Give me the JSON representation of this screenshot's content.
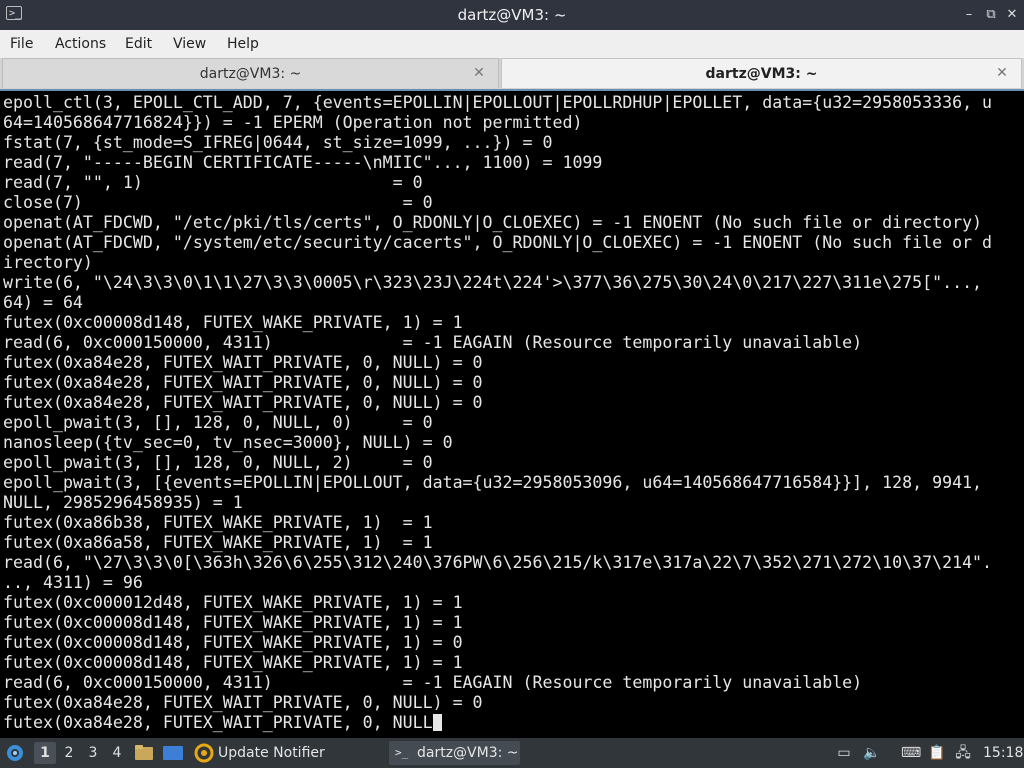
{
  "window": {
    "title": "dartz@VM3: ~",
    "controls": {
      "minimize": "–",
      "maximize": "⧉",
      "close": "✕"
    }
  },
  "menu": [
    "File",
    "Actions",
    "Edit",
    "View",
    "Help"
  ],
  "tabs": [
    {
      "label": "dartz@VM3: ~",
      "active": false
    },
    {
      "label": "dartz@VM3: ~",
      "active": true
    }
  ],
  "terminal": {
    "lines": [
      "epoll_ctl(3, EPOLL_CTL_ADD, 7, {events=EPOLLIN|EPOLLOUT|EPOLLRDHUP|EPOLLET, data={u32=2958053336, u",
      "64=140568647716824}}) = -1 EPERM (Operation not permitted)",
      "fstat(7, {st_mode=S_IFREG|0644, st_size=1099, ...}) = 0",
      "read(7, \"-----BEGIN CERTIFICATE-----\\nMIIC\"..., 1100) = 1099",
      "read(7, \"\", 1)                         = 0",
      "close(7)                                = 0",
      "openat(AT_FDCWD, \"/etc/pki/tls/certs\", O_RDONLY|O_CLOEXEC) = -1 ENOENT (No such file or directory)",
      "openat(AT_FDCWD, \"/system/etc/security/cacerts\", O_RDONLY|O_CLOEXEC) = -1 ENOENT (No such file or d",
      "irectory)",
      "write(6, \"\\24\\3\\3\\0\\1\\1\\27\\3\\3\\0005\\r\\323\\23J\\224t\\224'>\\377\\36\\275\\30\\24\\0\\217\\227\\311e\\275[\"...,",
      "64) = 64",
      "futex(0xc00008d148, FUTEX_WAKE_PRIVATE, 1) = 1",
      "read(6, 0xc000150000, 4311)             = -1 EAGAIN (Resource temporarily unavailable)",
      "futex(0xa84e28, FUTEX_WAIT_PRIVATE, 0, NULL) = 0",
      "futex(0xa84e28, FUTEX_WAIT_PRIVATE, 0, NULL) = 0",
      "futex(0xa84e28, FUTEX_WAIT_PRIVATE, 0, NULL) = 0",
      "epoll_pwait(3, [], 128, 0, NULL, 0)     = 0",
      "nanosleep({tv_sec=0, tv_nsec=3000}, NULL) = 0",
      "epoll_pwait(3, [], 128, 0, NULL, 2)     = 0",
      "epoll_pwait(3, [{events=EPOLLIN|EPOLLOUT, data={u32=2958053096, u64=140568647716584}}], 128, 9941,",
      "NULL, 2985296458935) = 1",
      "futex(0xa86b38, FUTEX_WAKE_PRIVATE, 1)  = 1",
      "futex(0xa86a58, FUTEX_WAKE_PRIVATE, 1)  = 1",
      "read(6, \"\\27\\3\\3\\0[\\363h\\326\\6\\255\\312\\240\\376PW\\6\\256\\215/k\\317e\\317a\\22\\7\\352\\271\\272\\10\\37\\214\".",
      ".., 4311) = 96",
      "futex(0xc000012d48, FUTEX_WAKE_PRIVATE, 1) = 1",
      "futex(0xc00008d148, FUTEX_WAKE_PRIVATE, 1) = 1",
      "futex(0xc00008d148, FUTEX_WAKE_PRIVATE, 1) = 0",
      "futex(0xc00008d148, FUTEX_WAKE_PRIVATE, 1) = 1",
      "read(6, 0xc000150000, 4311)             = -1 EAGAIN (Resource temporarily unavailable)",
      "futex(0xa84e28, FUTEX_WAIT_PRIVATE, 0, NULL) = 0",
      "futex(0xa84e28, FUTEX_WAIT_PRIVATE, 0, NULL"
    ]
  },
  "taskbar": {
    "workspaces": [
      "1",
      "2",
      "3",
      "4"
    ],
    "active_workspace": "1",
    "tasks": [
      {
        "label": "Update Notifier",
        "icon": "update-notifier-icon"
      },
      {
        "label": "dartz@VM3: ~",
        "icon": "terminal-icon"
      }
    ],
    "clock": "15:18"
  }
}
